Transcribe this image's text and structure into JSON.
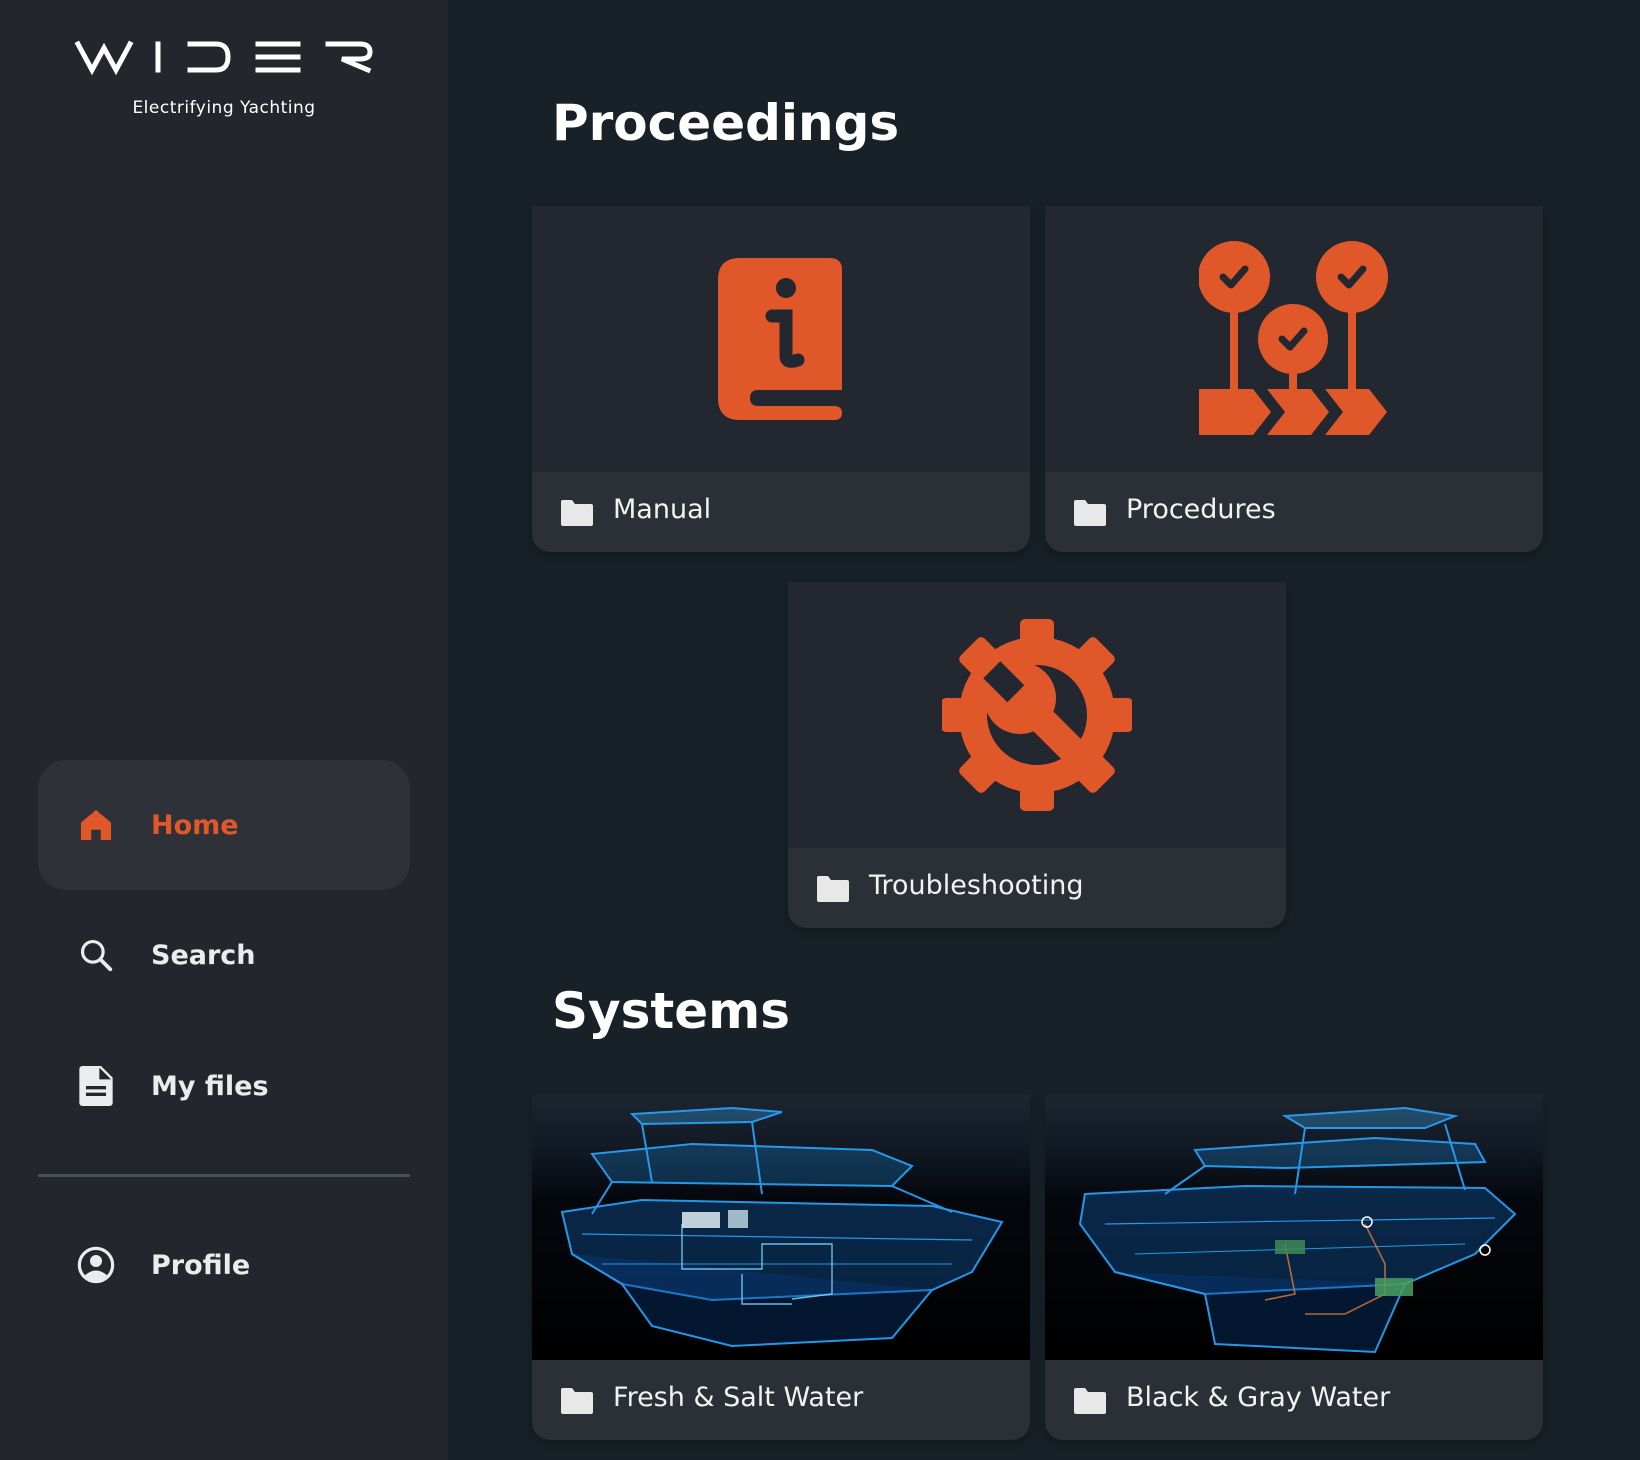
{
  "brand": {
    "logo_text": "WIDER",
    "tagline": "Electrifying Yachting"
  },
  "colors": {
    "accent": "#e0582a",
    "sidebar_bg": "#23272d",
    "main_bg": "#172127",
    "card_media_bg": "#23272f",
    "card_footer_bg": "#2b3036"
  },
  "nav": {
    "items": [
      {
        "label": "Home",
        "icon": "home-icon",
        "active": true
      },
      {
        "label": "Search",
        "icon": "search-icon",
        "active": false
      },
      {
        "label": "My files",
        "icon": "file-icon",
        "active": false
      },
      {
        "label": "Profile",
        "icon": "profile-icon",
        "active": false
      }
    ]
  },
  "proceedings": {
    "title": "Proceedings",
    "cards": [
      {
        "label": "Manual",
        "icon": "info-book-icon"
      },
      {
        "label": "Procedures",
        "icon": "procedures-checklist-icon"
      },
      {
        "label": "Troubleshooting",
        "icon": "gear-wrench-icon"
      }
    ]
  },
  "systems": {
    "title": "Systems",
    "cards": [
      {
        "label": "Fresh & Salt Water",
        "image": "yacht-fresh-salt-water-render"
      },
      {
        "label": "Black & Gray Water",
        "image": "yacht-black-gray-water-render"
      }
    ]
  }
}
